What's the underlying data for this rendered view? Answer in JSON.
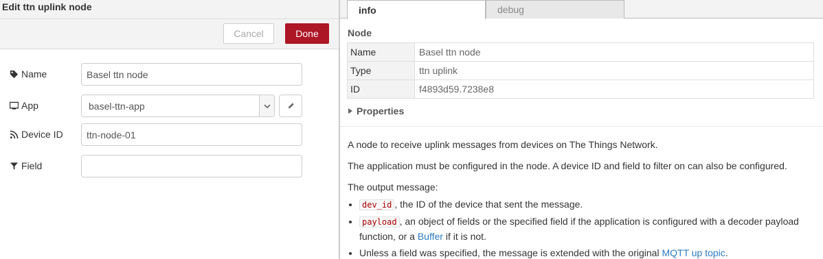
{
  "editor": {
    "title": "Edit ttn uplink node",
    "cancel_label": "Cancel",
    "done_label": "Done",
    "fields": {
      "name": {
        "label": "Name",
        "value": "Basel ttn node",
        "icon": "tag-icon"
      },
      "app": {
        "label": "App",
        "value": "basel-ttn-app",
        "icon": "monitor-icon"
      },
      "device_id": {
        "label": "Device ID",
        "value": "ttn-node-01",
        "icon": "rss-icon"
      },
      "field": {
        "label": "Field",
        "value": "",
        "icon": "filter-icon"
      }
    }
  },
  "sidebar": {
    "tabs": [
      "info",
      "debug"
    ],
    "node_heading": "Node",
    "node_info": [
      {
        "key": "Name",
        "value": "Basel ttn node"
      },
      {
        "key": "Type",
        "value": "ttn uplink"
      },
      {
        "key": "ID",
        "value": "f4893d59.7238e8"
      }
    ],
    "properties_label": "Properties",
    "help": {
      "p1": "A node to receive uplink messages from devices on The Things Network.",
      "p2": "The application must be configured in the node. A device ID and field to filter on can also be configured.",
      "p3": "The output message:",
      "items": [
        {
          "code": "dev_id",
          "text": ", the ID of the device that sent the message."
        },
        {
          "code": "payload",
          "text": ", an object of fields or the specified field if the application is configured with a decoder payload function, or a ",
          "link": "Buffer",
          "text_after": " if it is not."
        },
        {
          "text": "Unless a field was specified, the message is extended with the original ",
          "link": "MQTT up topic",
          "text_after": "."
        }
      ]
    }
  },
  "colors": {
    "done_button": "#ad1625",
    "link": "#2a7ac0",
    "code_text": "#aa0000"
  }
}
